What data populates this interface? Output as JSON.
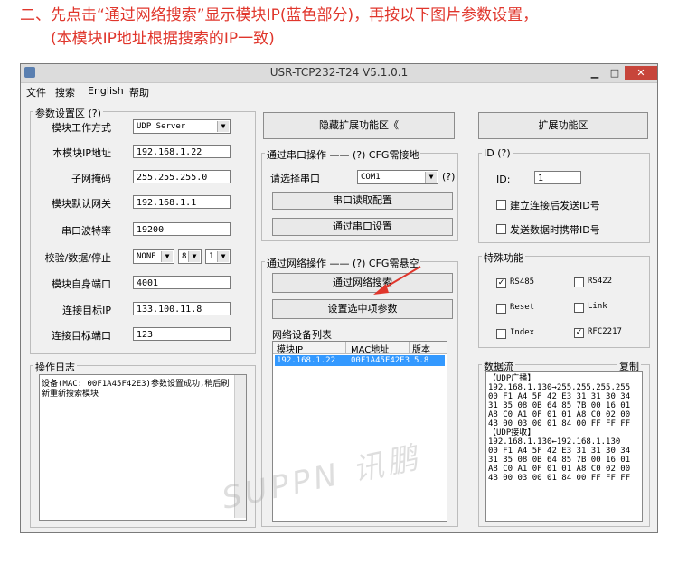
{
  "instruction": {
    "line1": "二、先点击“通过网络搜索”显示模块IP(蓝色部分)，再按以下图片参数设置，",
    "line2": "(本模块IP地址根据搜索的IP一致)"
  },
  "window": {
    "title": "USR-TCP232-T24 V5.1.0.1",
    "menu": [
      "文件",
      "搜索",
      "English",
      "帮助"
    ]
  },
  "params": {
    "group_label": "参数设置区 (?)",
    "work_mode_label": "模块工作方式",
    "work_mode_value": "UDP Server",
    "ip_label": "本模块IP地址",
    "ip_value": "192.168.1.22",
    "mask_label": "子网掩码",
    "mask_value": "255.255.255.0",
    "gateway_label": "模块默认网关",
    "gateway_value": "192.168.1.1",
    "baud_label": "串口波特率",
    "baud_value": "19200",
    "parity_label": "校验/数据/停止",
    "parity_value": "NONE",
    "data_value": "8",
    "stop_value": "1",
    "local_port_label": "模块自身端口",
    "local_port_value": "4001",
    "target_ip_label": "连接目标IP",
    "target_ip_value": "133.100.11.8",
    "target_port_label": "连接目标端口",
    "target_port_value": "123"
  },
  "log": {
    "label": "操作日志",
    "text_line1": "设备(MAC: 00F1A45F42E3)参数设置成功,稍后刷",
    "text_line2": "新重新搜索模块"
  },
  "middle": {
    "hide_btn": "隐藏扩展功能区《",
    "serial_group": "通过串口操作 —— (?) CFG需接地",
    "choose_port_label": "请选择串口",
    "port_value": "COM1",
    "help_q": "(?)",
    "read_cfg_btn": "串口读取配置",
    "serial_set_btn": "通过串口设置",
    "net_group": "通过网络操作 —— (?) CFG需悬空",
    "net_search_btn": "通过网络搜索",
    "set_selected_btn": "设置选中项参数",
    "device_list_label": "网络设备列表",
    "columns": [
      "模块IP",
      "MAC地址",
      "版本"
    ],
    "rows": [
      [
        "192.168.1.22",
        "00F1A45F42E3",
        "5.8"
      ]
    ]
  },
  "right": {
    "ext_btn": "扩展功能区",
    "id_group": "ID (?)",
    "id_label": "ID:",
    "id_value": "1",
    "id_connect_label": "建立连接后发送ID号",
    "id_data_label": "发送数据时携带ID号",
    "special_group": "特殊功能",
    "rs485": "RS485",
    "rs422": "RS422",
    "reset": "Reset",
    "link": "Link",
    "index": "Index",
    "rfc2217": "RFC2217",
    "data_group": "数据流",
    "copy": "复制",
    "stream": [
      "【UDP广播】",
      "192.168.1.130→255.255.255.255",
      "00 F1 A4 5F 42 E3 31 31 30 34",
      "31 35 08 0B 64 85 7B 00 16 01",
      "A8 C0 A1 0F 01 01 A8 C0 02 00",
      "4B 00 03 00 01 84 00 FF FF FF",
      "【UDP接收】",
      "192.168.1.130←192.168.1.130",
      "00 F1 A4 5F 42 E3 31 31 30 34",
      "31 35 08 0B 64 85 7B 00 16 01",
      "A8 C0 A1 0F 01 01 A8 C0 02 00",
      "4B 00 03 00 01 84 00 FF FF FF"
    ]
  },
  "watermark": "SUPPN 讯鹏",
  "colors": {
    "accent_red": "#e0362c",
    "selection_blue": "#3399ff"
  }
}
